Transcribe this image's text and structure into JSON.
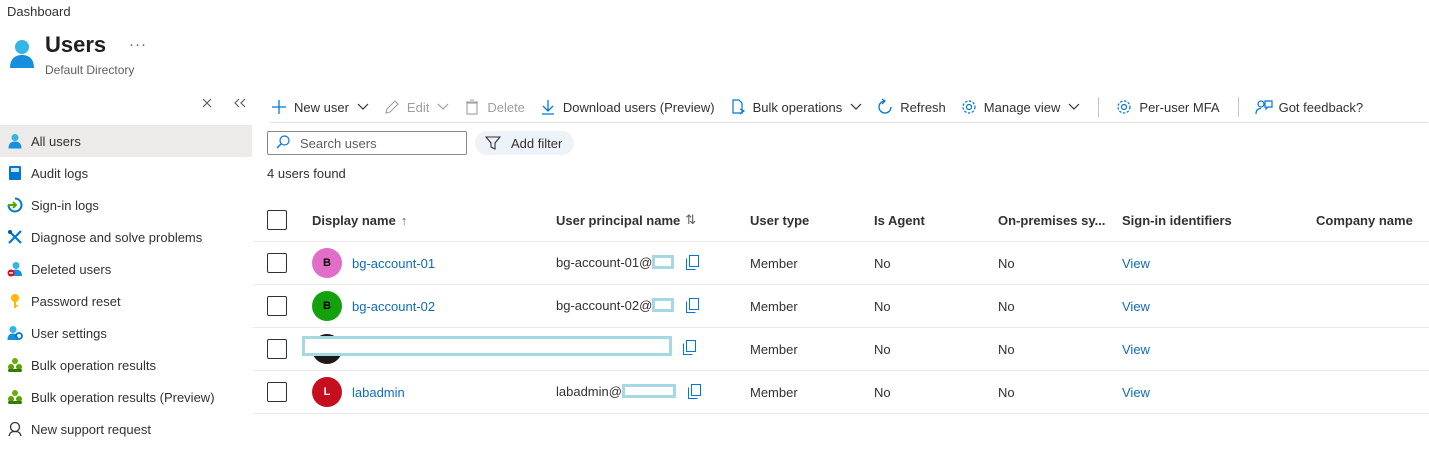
{
  "breadcrumb": "Dashboard",
  "page": {
    "title": "Users",
    "more": "···",
    "subtitle": "Default Directory"
  },
  "sidebar": {
    "items": [
      {
        "label": "All users",
        "icon": "user-icon",
        "active": true
      },
      {
        "label": "Audit logs",
        "icon": "book-icon"
      },
      {
        "label": "Sign-in logs",
        "icon": "sign-in-icon"
      },
      {
        "label": "Diagnose and solve problems",
        "icon": "wrench-icon"
      },
      {
        "label": "Deleted users",
        "icon": "deleted-user-icon"
      },
      {
        "label": "Password reset",
        "icon": "key-icon"
      },
      {
        "label": "User settings",
        "icon": "user-settings-icon"
      },
      {
        "label": "Bulk operation results",
        "icon": "group-icon"
      },
      {
        "label": "Bulk operation results (Preview)",
        "icon": "group-icon"
      },
      {
        "label": "New support request",
        "icon": "support-icon"
      }
    ]
  },
  "toolbar": {
    "new_user": "New user",
    "edit": "Edit",
    "delete": "Delete",
    "download": "Download users (Preview)",
    "bulk": "Bulk operations",
    "refresh": "Refresh",
    "manage_view": "Manage view",
    "per_user_mfa": "Per-user MFA",
    "feedback": "Got feedback?"
  },
  "search": {
    "placeholder": "Search users"
  },
  "filter": {
    "label": "Add filter"
  },
  "count_text": "4 users found",
  "columns": {
    "display_name": "Display name",
    "display_name_sort": "↑",
    "upn": "User principal name",
    "upn_sort": "⇅",
    "user_type": "User type",
    "is_agent": "Is Agent",
    "on_prem": "On-premises sy...",
    "sign_in": "Sign-in identifiers",
    "company": "Company name"
  },
  "rows": [
    {
      "initial": "B",
      "avatar_color": "#e06ec8",
      "display_name": "bg-account-01",
      "upn": "bg-account-01@",
      "user_type": "Member",
      "is_agent": "No",
      "on_prem": "No",
      "sign_in": "View"
    },
    {
      "initial": "B",
      "avatar_color": "#13a10e",
      "display_name": "bg-account-02",
      "upn": "bg-account-02@",
      "user_type": "Member",
      "is_agent": "No",
      "on_prem": "No",
      "sign_in": "View"
    },
    {
      "initial": "",
      "avatar_color": "#1b1a19",
      "display_name": "",
      "upn": "",
      "user_type": "Member",
      "is_agent": "No",
      "on_prem": "No",
      "sign_in": "View"
    },
    {
      "initial": "L",
      "avatar_color": "#c50f1f",
      "display_name": "labadmin",
      "upn": "labadmin@",
      "user_type": "Member",
      "is_agent": "No",
      "on_prem": "No",
      "sign_in": "View"
    }
  ],
  "colors": {
    "accent": "#0f6cbd",
    "active_bg": "#edebe9",
    "redaction": "#a6d8e3"
  }
}
